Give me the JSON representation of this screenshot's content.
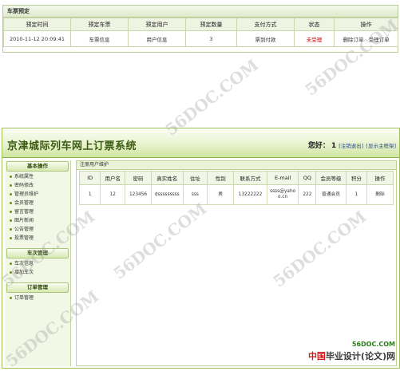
{
  "booking": {
    "title": "车票预定",
    "headers": [
      "预定时间",
      "预定车票",
      "预定用户",
      "预定数量",
      "支付方式",
      "状态",
      "操作"
    ],
    "row": {
      "time": "2010-11-12 20:09:41",
      "ticket": "车票信息",
      "user": "用户信息",
      "qty": "3",
      "pay": "票到付款",
      "status": "未受理",
      "delete": "删除订单",
      "accept": "受理订单"
    }
  },
  "app": {
    "title": "京津城际列车网上订票系统",
    "greeting": "您好：",
    "username": "1",
    "logout": "[注销退出]",
    "show_main": "[显示主框架]"
  },
  "sidebar": {
    "sections": [
      {
        "title": "基本操作",
        "items": [
          "系统属性",
          "密码修改",
          "管理员维护",
          "会员管理",
          "留言管理",
          "图片新闻",
          "公告管理",
          "投票管理"
        ]
      },
      {
        "title": "车次管理",
        "items": [
          "车次信息",
          "增加车次"
        ]
      },
      {
        "title": "订单管理",
        "items": [
          "订单管理"
        ]
      }
    ]
  },
  "users": {
    "title": "注册用户维护",
    "headers": [
      "ID",
      "用户名",
      "密码",
      "真实姓名",
      "住址",
      "性别",
      "联系方式",
      "E-mail",
      "QQ",
      "会员等级",
      "积分",
      "操作"
    ],
    "row": {
      "id": "1",
      "username": "12",
      "password": "123456",
      "realname": "dsssssssss",
      "address": "sss",
      "gender": "男",
      "phone": "13222222",
      "email": "ssss@yahoo.cn",
      "qq": "222",
      "level": "普通会员",
      "points": "1",
      "action": "删除"
    }
  },
  "watermark": "56DOC.COM",
  "footer": {
    "site": "56DOC.COM",
    "brand_cn": "中国",
    "brand_rest": "毕业设计(论文)网"
  }
}
